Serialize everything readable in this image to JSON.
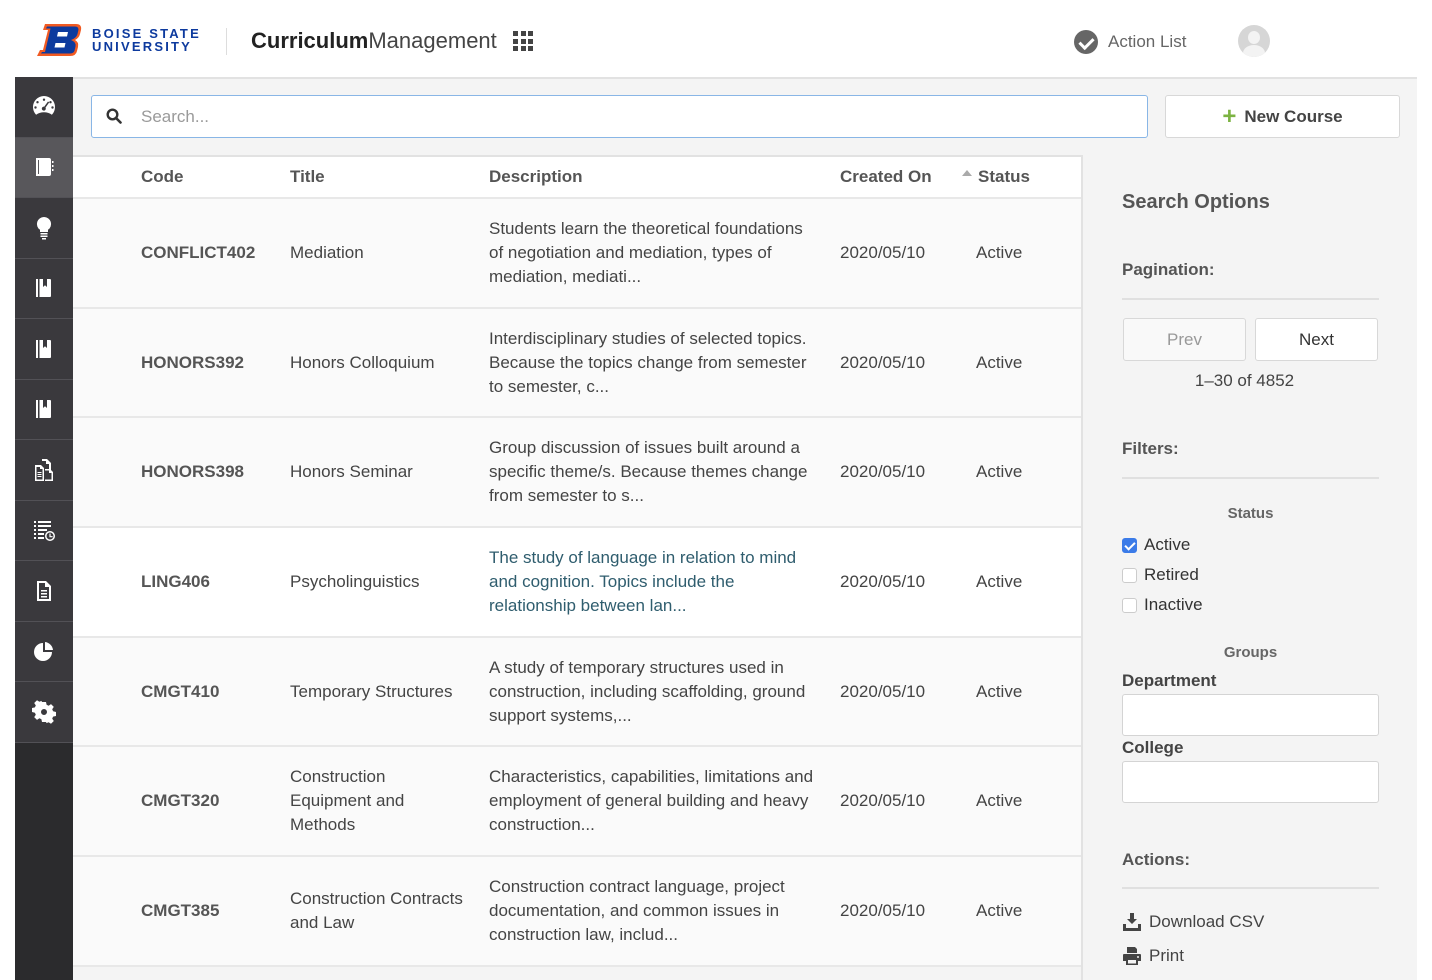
{
  "header": {
    "logo_line1": "BOISE STATE",
    "logo_line2": "UNIVERSITY",
    "app_title_bold": "Curriculum",
    "app_title_light": "Management",
    "apps_icon": "grid-icon",
    "action_list_label": "Action List",
    "action_list_icon": "check-circle-icon",
    "avatar_icon": "user-avatar-icon"
  },
  "brand_colors": {
    "logo_blue": "#0d3a9e",
    "logo_orange": "#f15a22",
    "accent_green": "#7cb342",
    "checkbox_blue": "#3b7be8",
    "sidebar_dark": "#3a393d",
    "sidebar_active": "#58575b"
  },
  "sidebar": {
    "items": [
      {
        "icon": "dashboard-gauge-icon",
        "active": false
      },
      {
        "icon": "notebook-icon",
        "active": true
      },
      {
        "icon": "lightbulb-icon",
        "active": false
      },
      {
        "icon": "book-bookmark-icon",
        "active": false
      },
      {
        "icon": "book-bookmark-icon",
        "active": false
      },
      {
        "icon": "book-bookmark-icon",
        "active": false
      },
      {
        "icon": "documents-icon",
        "active": false
      },
      {
        "icon": "list-clock-icon",
        "active": false
      },
      {
        "icon": "file-text-icon",
        "active": false
      },
      {
        "icon": "pie-chart-icon",
        "active": false
      },
      {
        "icon": "gear-icon",
        "active": false
      }
    ]
  },
  "search": {
    "placeholder": "Search...",
    "value": ""
  },
  "toolbar": {
    "new_course_label": "New Course"
  },
  "table": {
    "columns": [
      "Code",
      "Title",
      "Description",
      "Created On",
      "Status"
    ],
    "sorted_column": "Status",
    "sort_direction": "ascending",
    "rows": [
      {
        "code": "CONFLICT402",
        "title": "Mediation",
        "description": "Students learn the theoretical foundations of negotiation and mediation, types of mediation, mediati...",
        "created_on": "2020/05/10",
        "status": "Active",
        "hover": false
      },
      {
        "code": "HONORS392",
        "title": "Honors Colloquium",
        "description": "Interdisciplinary studies of selected topics. Because the topics change from semester to semester, c...",
        "created_on": "2020/05/10",
        "status": "Active",
        "hover": false
      },
      {
        "code": "HONORS398",
        "title": "Honors Seminar",
        "description": "Group discussion of issues built around a specific theme/s. Because themes change from semester to s...",
        "created_on": "2020/05/10",
        "status": "Active",
        "hover": false
      },
      {
        "code": "LING406",
        "title": "Psycholinguistics",
        "description": "The study of language in relation to mind and cognition. Topics include the relationship between lan...",
        "created_on": "2020/05/10",
        "status": "Active",
        "hover": true
      },
      {
        "code": "CMGT410",
        "title": "Temporary Structures",
        "description": "A study of temporary structures used in construction, including scaffolding, ground support systems,...",
        "created_on": "2020/05/10",
        "status": "Active",
        "hover": false
      },
      {
        "code": "CMGT320",
        "title": "Construction Equipment and Methods",
        "description": "Characteristics, capabilities, limitations and employment of general building and heavy construction...",
        "created_on": "2020/05/10",
        "status": "Active",
        "hover": false
      },
      {
        "code": "CMGT385",
        "title": "Construction Contracts and Law",
        "description": "Construction contract language, project documentation, and common issues in construction law, includ...",
        "created_on": "2020/05/10",
        "status": "Active",
        "hover": false
      }
    ]
  },
  "options": {
    "title": "Search Options",
    "pagination_label": "Pagination:",
    "prev_label": "Prev",
    "next_label": "Next",
    "range_text": "1–30 of 4852",
    "filters_label": "Filters:",
    "status_heading": "Status",
    "status_filters": [
      {
        "label": "Active",
        "checked": true
      },
      {
        "label": "Retired",
        "checked": false
      },
      {
        "label": "Inactive",
        "checked": false
      }
    ],
    "groups_heading": "Groups",
    "department_label": "Department",
    "department_value": "",
    "college_label": "College",
    "college_value": "",
    "actions_label": "Actions:",
    "actions": [
      {
        "label": "Download CSV",
        "icon": "download-icon"
      },
      {
        "label": "Print",
        "icon": "printer-icon"
      }
    ]
  }
}
